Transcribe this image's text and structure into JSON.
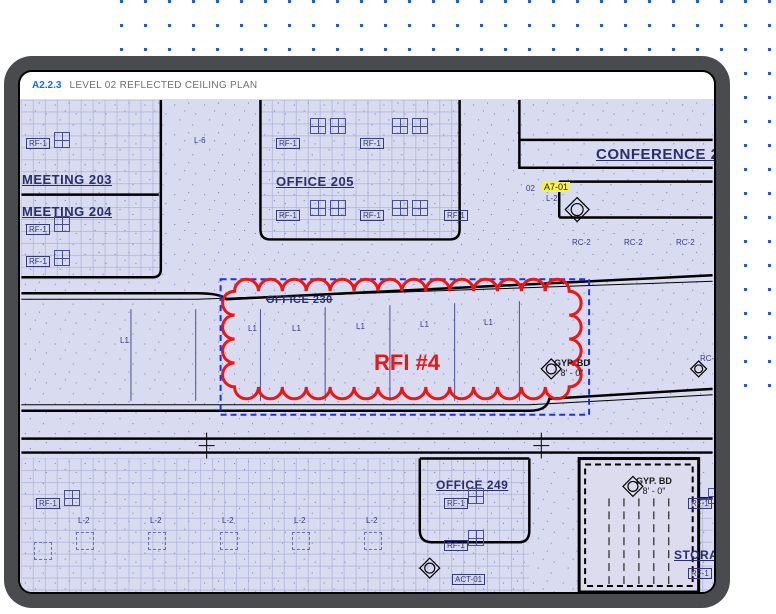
{
  "background": {
    "dot_color": "#2b59d9",
    "dot_gap": 24
  },
  "titlebar": {
    "sheet_code": "A2.2.3",
    "sheet_title": "LEVEL 02 REFLECTED CEILING PLAN"
  },
  "markup": {
    "rfi_label": "RFI #4",
    "selection_color": "#1a2ff0",
    "cloud_color": "#f01414"
  },
  "rooms": {
    "meeting_203": "MEETING   203",
    "meeting_204": "MEETING   204",
    "office_205": "OFFICE   205",
    "office_230": "OFFICE  230",
    "office_249": "OFFICE  249",
    "conference_2": "CONFERENCE   2",
    "storage": "STORAG"
  },
  "ceiling_tags": {
    "rf1": "RF-1",
    "l1": "L1",
    "l2": "L-2",
    "l6": "L-6",
    "rc2": "RC-2",
    "act01": "ACT-01",
    "gyp_bd": "GYP. BD",
    "gyp_height": "8' - 0\"",
    "callout_a701": "A7-01",
    "level_marker": "02"
  }
}
